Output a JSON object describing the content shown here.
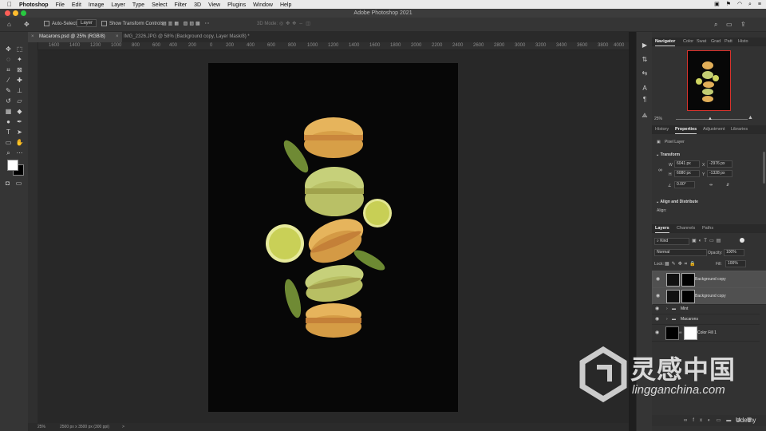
{
  "mac_menu": {
    "apple": "",
    "app": "Photoshop",
    "items": [
      "File",
      "Edit",
      "Image",
      "Layer",
      "Type",
      "Select",
      "Filter",
      "3D",
      "View",
      "Plugins",
      "Window",
      "Help"
    ]
  },
  "window": {
    "title": "Adobe Photoshop 2021"
  },
  "options_bar": {
    "auto_select": "Auto-Select:",
    "auto_select_value": "Layer",
    "show_transform": "Show Transform Controls",
    "mode_3d": "3D Mode:"
  },
  "tabs": [
    {
      "label": "Macarons.psd @ 25% (RGB/8)"
    },
    {
      "label": "IMG_2326.JPG @ 58% (Background copy, Layer Mask/8) *"
    }
  ],
  "ruler_ticks": [
    "1600",
    "1400",
    "1200",
    "1000",
    "800",
    "600",
    "400",
    "200",
    "0",
    "200",
    "400",
    "600",
    "800",
    "1000",
    "1200",
    "1400",
    "1600",
    "1800",
    "2000",
    "2200",
    "2400",
    "2600",
    "2800",
    "3000",
    "3200",
    "3400",
    "3600",
    "3800",
    "4000"
  ],
  "status": {
    "zoom": "25%",
    "doc_size": "2500 px x 3500 px (300 ppi)",
    "arrow": ">"
  },
  "navigator": {
    "tabs": [
      "Navigator",
      "Color",
      "Swat",
      "Grad",
      "Patt",
      "Histo"
    ],
    "zoom": "25%"
  },
  "properties": {
    "tabs": [
      "History",
      "Properties",
      "Adjustment",
      "Libraries"
    ],
    "kind": "Pixel Layer",
    "transform_heading": "Transform",
    "w_label": "W",
    "w_value": "6041 px",
    "h_label": "H",
    "h_value": "6080 px",
    "x_label": "X",
    "x_value": "-2976 px",
    "y_label": "Y",
    "y_value": "-1328 px",
    "angle": "0.00°",
    "align_heading": "Align and Distribute",
    "align_sub": "Align:"
  },
  "layers_panel": {
    "tabs": [
      "Layers",
      "Channels",
      "Paths"
    ],
    "filter": "Kind",
    "blend_mode": "Normal",
    "opacity_label": "Opacity:",
    "opacity": "100%",
    "lock_label": "Lock:",
    "fill_label": "Fill:",
    "fill": "100%",
    "layers": [
      {
        "name": "Background copy",
        "selected": true
      },
      {
        "name": "Background copy",
        "selected": true
      },
      {
        "name": "Mint",
        "selected": false
      },
      {
        "name": "Macarons",
        "selected": false
      },
      {
        "name": "Color Fill 1",
        "selected": false
      }
    ]
  },
  "watermark": {
    "cn": "灵感中国",
    "url": "lingganchina.com",
    "udemy": "Udemy"
  },
  "colors": {
    "accent": "#2d8ceb",
    "swatch_fg": "#ffffff",
    "swatch_bg": "#000000",
    "mac_red": "#ff5f57",
    "mac_yellow": "#febc2e",
    "mac_green": "#28c840"
  }
}
